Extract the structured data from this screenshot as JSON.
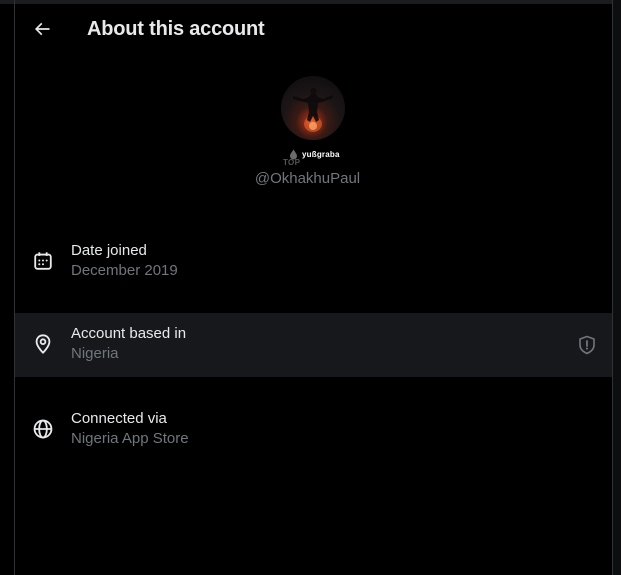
{
  "header": {
    "back_icon": "arrow-left-icon",
    "title": "About this account"
  },
  "profile": {
    "avatar_icon": "profile-avatar",
    "watermark_prefix": "TOP",
    "watermark_brand": "yußgraba",
    "handle": "@OkhakhuPaul"
  },
  "details": [
    {
      "icon": "calendar-icon",
      "title": "Date joined",
      "value": "December 2019"
    },
    {
      "icon": "location-pin-icon",
      "title": "Account based in",
      "value": "Nigeria",
      "badge_icon": "shield-alert-icon"
    },
    {
      "icon": "globe-icon",
      "title": "Connected via",
      "value": "Nigeria App Store"
    }
  ],
  "colors": {
    "background": "#000000",
    "primary_text": "#e7e9ea",
    "secondary_text": "#71767b",
    "highlight_row": "#16181c",
    "border": "#2f3336"
  }
}
